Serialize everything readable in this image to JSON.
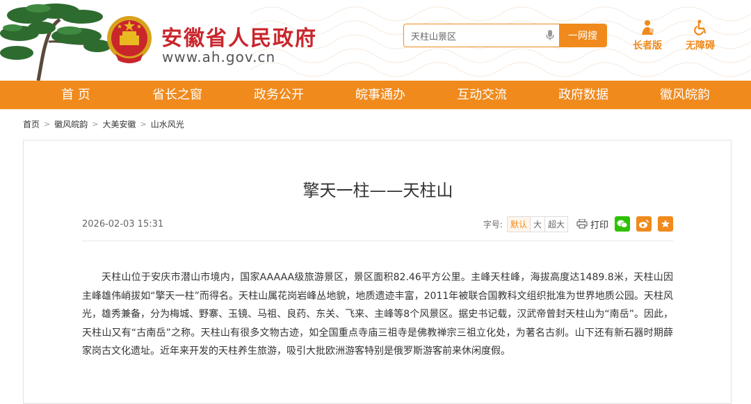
{
  "site": {
    "name": "安徽省人民政府",
    "url": "www.ah.gov.cn"
  },
  "search": {
    "value": "天柱山景区",
    "button_label": "一网搜"
  },
  "tools": {
    "elder_label": "长者版",
    "accessibility_label": "无障碍"
  },
  "nav": {
    "items": [
      "首 页",
      "省长之窗",
      "政务公开",
      "皖事通办",
      "互动交流",
      "政府数据",
      "徽风皖韵"
    ],
    "active_index": 6
  },
  "breadcrumb": {
    "items": [
      "首页",
      "徽风皖韵",
      "大美安徽",
      "山水风光"
    ]
  },
  "article": {
    "title": "擎天一柱——天柱山",
    "date": "2026-02-03 15:31",
    "font_label": "字号:",
    "font_sizes": [
      "默认",
      "大",
      "超大"
    ],
    "print_label": "打印",
    "body": "天柱山位于安庆市潜山市境内，国家AAAAA级旅游景区，景区面积82.46平方公里。主峰天柱峰，海拔高度达1489.8米，天柱山因主峰雄伟峭拔如“擎天一柱”而得名。天柱山属花岗岩峰丛地貌，地质遗迹丰富，2011年被联合国教科文组织批准为世界地质公园。天柱风光，雄秀兼备，分为梅城、野寨、玉镜、马祖、良药、东关、飞来、主峰等8个风景区。据史书记载，汉武帝曾封天柱山为“南岳”。因此，天柱山又有“古南岳”之称。天柱山有很多文物古迹，如全国重点寺庙三祖寺是佛教禅宗三祖立化处，为著名古刹。山下还有新石器时期薛家岗古文化遗址。近年来开发的天柱养生旅游，吸引大批欧洲游客特别是俄罗斯游客前来休闲度假。"
  },
  "colors": {
    "brand_orange": "#f08a1c",
    "title_red": "#c9262c",
    "wechat_green": "#2dc100",
    "weibo_orange": "#f08a1c",
    "favorite_orange": "#f08a1c"
  },
  "icons": [
    "pine-tree-icon",
    "national-emblem-icon",
    "mic-icon",
    "elder-icon",
    "wheelchair-icon",
    "print-icon",
    "wechat-icon",
    "weibo-icon",
    "star-icon"
  ]
}
